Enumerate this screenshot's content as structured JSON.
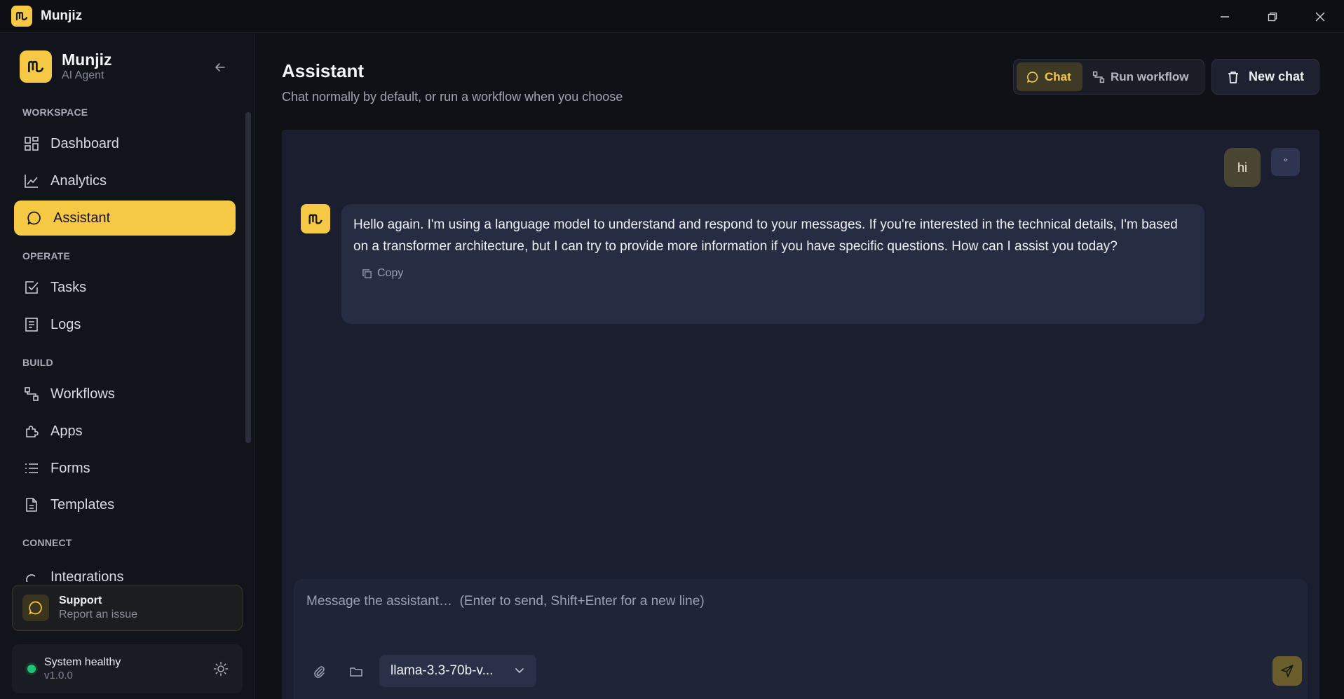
{
  "window": {
    "title": "Munjiz"
  },
  "sidebar": {
    "brand_name": "Munjiz",
    "brand_sub": "AI Agent",
    "sections": {
      "workspace": "WORKSPACE",
      "operate": "OPERATE",
      "build": "BUILD",
      "connect": "CONNECT"
    },
    "items": {
      "dashboard": "Dashboard",
      "analytics": "Analytics",
      "assistant": "Assistant",
      "tasks": "Tasks",
      "logs": "Logs",
      "workflows": "Workflows",
      "apps": "Apps",
      "forms": "Forms",
      "templates": "Templates",
      "integrations": "Integrations"
    },
    "support": {
      "title": "Support",
      "sub": "Report an issue"
    },
    "status": {
      "title": "System healthy",
      "version": "v1.0.0"
    }
  },
  "main": {
    "title": "Assistant",
    "subtitle": "Chat normally by default, or run a workflow when you choose",
    "mode": {
      "chat": "Chat",
      "run": "Run workflow",
      "selected": "Chat"
    },
    "new_chat": "New chat"
  },
  "chat": {
    "user_message": "hi",
    "user_avatar": "°",
    "assistant_message": "Hello again. I'm using a language model to understand and respond to your messages. If you're interested in the technical details, I'm based on a transformer architecture, but I can try to provide more information if you have specific questions. How can I assist you today?",
    "copy_label": "Copy"
  },
  "composer": {
    "placeholder": "Message the assistant…  (Enter to send, Shift+Enter for a new line)",
    "model": "llama-3.3-70b-v..."
  },
  "colors": {
    "accent": "#f6c945",
    "sidebar_bg": "#12141b",
    "chat_panel_bg": "#1a1e2e",
    "assistant_bubble": "#262c42",
    "user_bubble": "#4a4432",
    "status_healthy": "#21c27a"
  },
  "icons": {
    "brand": "munjiz-logo-icon",
    "dashboard": "grid-icon",
    "analytics": "line-chart-icon",
    "assistant": "chat-bubble-icon",
    "tasks": "checkbox-icon",
    "logs": "list-document-icon",
    "workflows": "workflow-icon",
    "apps": "puzzle-icon",
    "forms": "list-icon",
    "templates": "file-icon",
    "collapse": "arrow-left-icon",
    "support": "chat-bubble-icon",
    "theme": "sun-icon",
    "new_chat": "trash-icon",
    "copy": "copy-icon",
    "attach": "paperclip-icon",
    "folder": "folder-icon",
    "send": "send-icon",
    "chevron": "chevron-down-icon"
  }
}
